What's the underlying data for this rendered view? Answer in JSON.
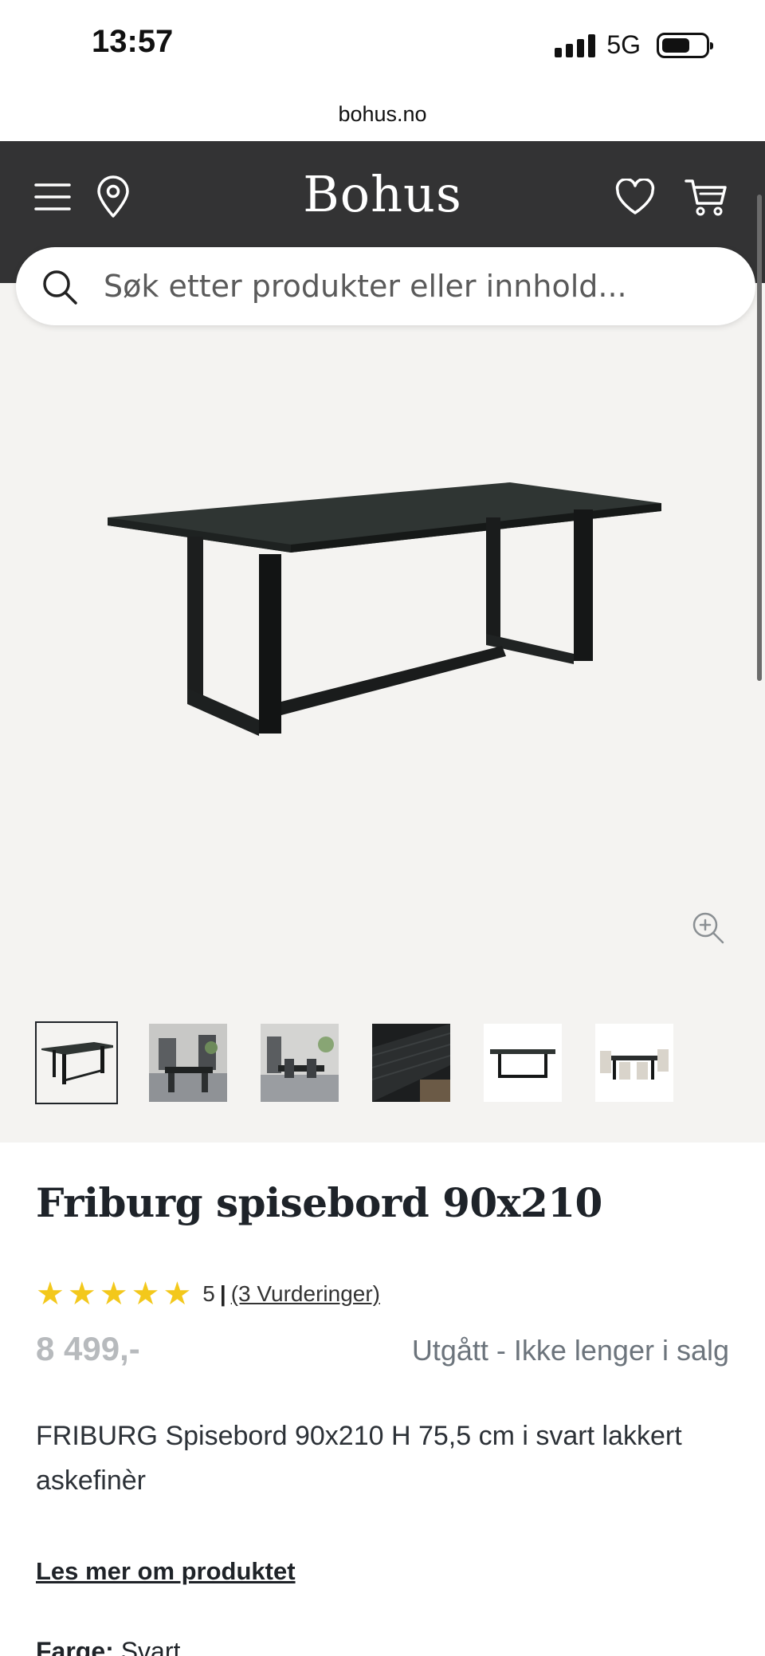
{
  "status_bar": {
    "time": "13:57",
    "network": "5G"
  },
  "browser": {
    "url": "bohus.no"
  },
  "header": {
    "logo": "Bohus",
    "icons": [
      "menu-icon",
      "location-pin-icon",
      "heart-icon",
      "cart-icon"
    ],
    "background_color": "#333334"
  },
  "search": {
    "placeholder": "Søk etter produkter eller innhold..."
  },
  "gallery": {
    "thumbnail_count": 6,
    "selected_index": 0
  },
  "product": {
    "title": "Friburg spisebord 90x210",
    "rating_value": "5",
    "rating_separator": "|",
    "reviews_link": "(3 Vurderinger)",
    "star_count": 5,
    "price": "8 499,-",
    "status": "Utgått - Ikke lenger i salg",
    "description": "FRIBURG Spisebord 90x210 H 75,5 cm i svart lakkert askefinèr",
    "read_more": "Les mer om produktet",
    "color_label": "Farge:",
    "color_value": "Svart",
    "star_color": "#f3c81b"
  }
}
